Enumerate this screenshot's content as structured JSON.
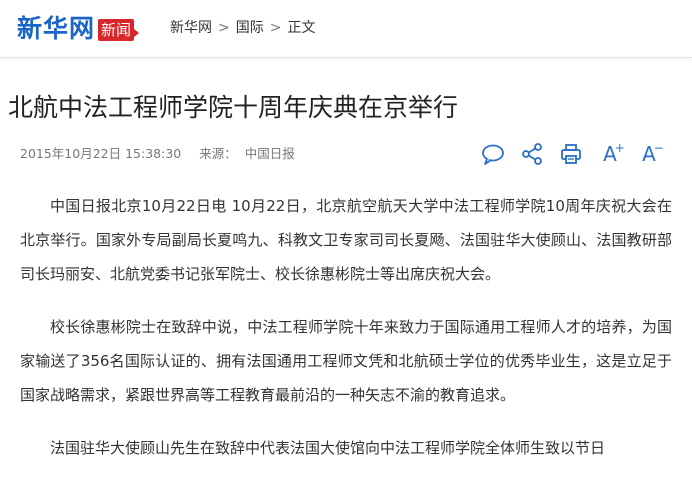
{
  "header": {
    "logo_text": "新华网",
    "logo_badge": "新闻",
    "breadcrumb": [
      "新华网",
      "国际",
      "正文"
    ],
    "breadcrumb_sep": ">"
  },
  "article": {
    "title": "北航中法工程师学院十周年庆典在京举行",
    "date": "2015年10月22日 15:38:30",
    "source_label": "来源：",
    "source": "中国日报",
    "paragraphs": [
      "中国日报北京10月22日电 10月22日，北京航空航天大学中法工程师学院10周年庆祝大会在北京举行。国家外专局副局长夏鸣九、科教文卫专家司司长夏飏、法国驻华大使顾山、法国教研部司长玛丽安、北航党委书记张军院士、校长徐惠彬院士等出席庆祝大会。",
      "校长徐惠彬院士在致辞中说，中法工程师学院十年来致力于国际通用工程师人才的培养，为国家输送了356名国际认证的、拥有法国通用工程师文凭和北航硕士学位的优秀毕业生，这是立足于国家战略需求，紧跟世界高等工程教育最前沿的一种矢志不渝的教育追求。",
      "法国驻华大使顾山先生在致辞中代表法国大使馆向中法工程师学院全体师生致以节日"
    ]
  },
  "tools": {
    "font_increase": "A",
    "font_decrease": "A",
    "plus": "+",
    "minus": "−"
  },
  "colors": {
    "logo_blue": "#1b64c8",
    "badge_red": "#d9262b",
    "tool_blue": "#2a6fc9"
  }
}
